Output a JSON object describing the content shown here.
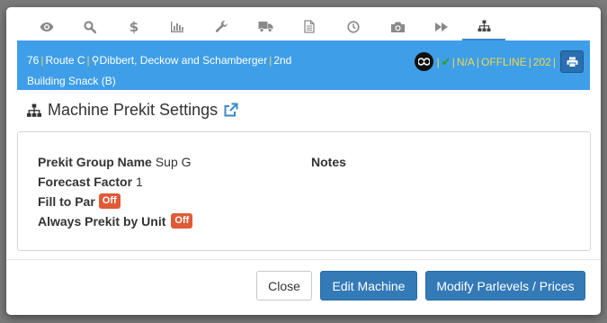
{
  "background": {
    "snippets": [
      "Sup G",
      "Sup G"
    ]
  },
  "tabs": [
    {
      "icon": "eye-icon"
    },
    {
      "icon": "search-icon"
    },
    {
      "icon": "dollar-icon"
    },
    {
      "icon": "bar-chart-icon"
    },
    {
      "icon": "wrench-icon"
    },
    {
      "icon": "truck-icon"
    },
    {
      "icon": "document-icon"
    },
    {
      "icon": "clock-icon"
    },
    {
      "icon": "camera-icon"
    },
    {
      "icon": "fast-forward-icon"
    },
    {
      "icon": "sitemap-icon",
      "active": true
    }
  ],
  "header": {
    "machine_id": "76",
    "route": "Route C",
    "location": "Dibbert, Deckow and Schamberger",
    "floor": "2nd",
    "machine_name": "Building Snack (B)",
    "status_na": "N/A",
    "status_offline": "OFFLINE",
    "code": "202",
    "colors": {
      "bar": "#3e9ee8",
      "accent": "#f0d94a"
    }
  },
  "section": {
    "title": "Machine Prekit Settings"
  },
  "settings": {
    "group_name_label": "Prekit Group Name",
    "group_name_value": "Sup G",
    "forecast_label": "Forecast Factor",
    "forecast_value": "1",
    "fill_to_par_label": "Fill to Par",
    "fill_to_par_value": "Off",
    "always_prekit_label": "Always Prekit by Unit",
    "always_prekit_value": "Off",
    "notes_label": "Notes"
  },
  "footer": {
    "close_label": "Close",
    "edit_label": "Edit Machine",
    "modify_label": "Modify Parlevels / Prices"
  }
}
